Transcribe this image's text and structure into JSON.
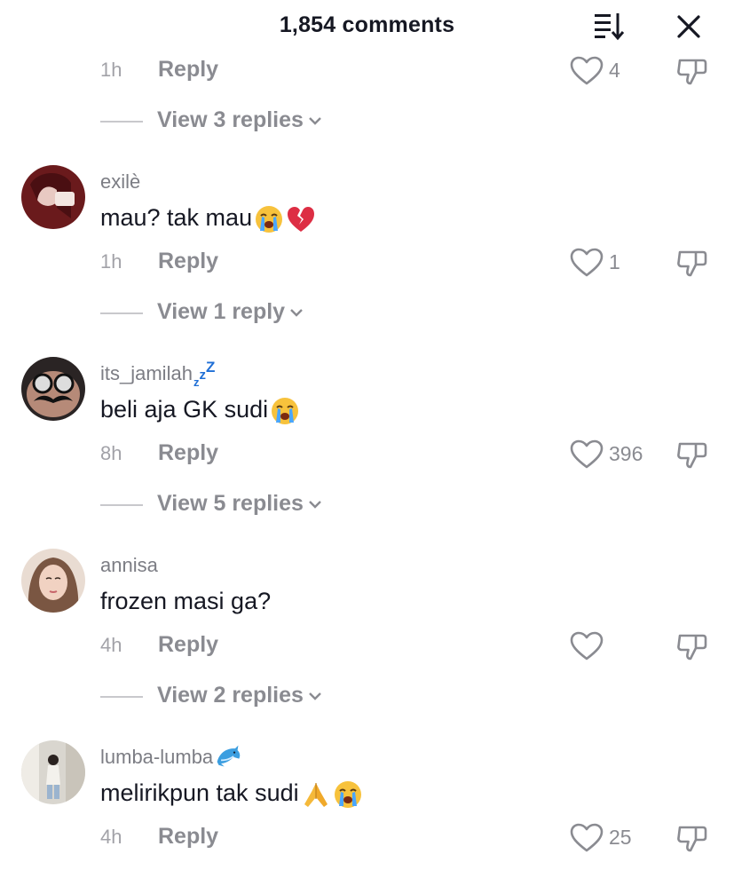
{
  "header": {
    "title": "1,854 comments",
    "sort_icon": "sort-icon",
    "close_icon": "close-icon"
  },
  "reply_label": "Reply",
  "top_partial": {
    "time": "1h",
    "likes": "4",
    "view_replies": "View 3 replies"
  },
  "comments": [
    {
      "username": "exilè",
      "text": "mau? tak mau",
      "emojis": [
        "loudly-crying-face",
        "broken-heart"
      ],
      "time": "1h",
      "likes": "1",
      "view_replies": "View 1 reply"
    },
    {
      "username": "its_jamilah",
      "username_suffix_icon": "zzz-icon",
      "text": "beli aja GK sudi",
      "emojis": [
        "loudly-crying-face"
      ],
      "time": "8h",
      "likes": "396",
      "view_replies": "View 5 replies"
    },
    {
      "username": "annisa",
      "text": "frozen masi ga?",
      "emojis": [],
      "time": "4h",
      "likes": "",
      "view_replies": "View 2 replies"
    },
    {
      "username": "lumba-lumba",
      "username_suffix_icon": "dolphin-icon",
      "text": "melirikpun tak sudi",
      "emojis": [
        "folded-hands",
        "loudly-crying-face"
      ],
      "time": "4h",
      "likes": "25"
    }
  ]
}
